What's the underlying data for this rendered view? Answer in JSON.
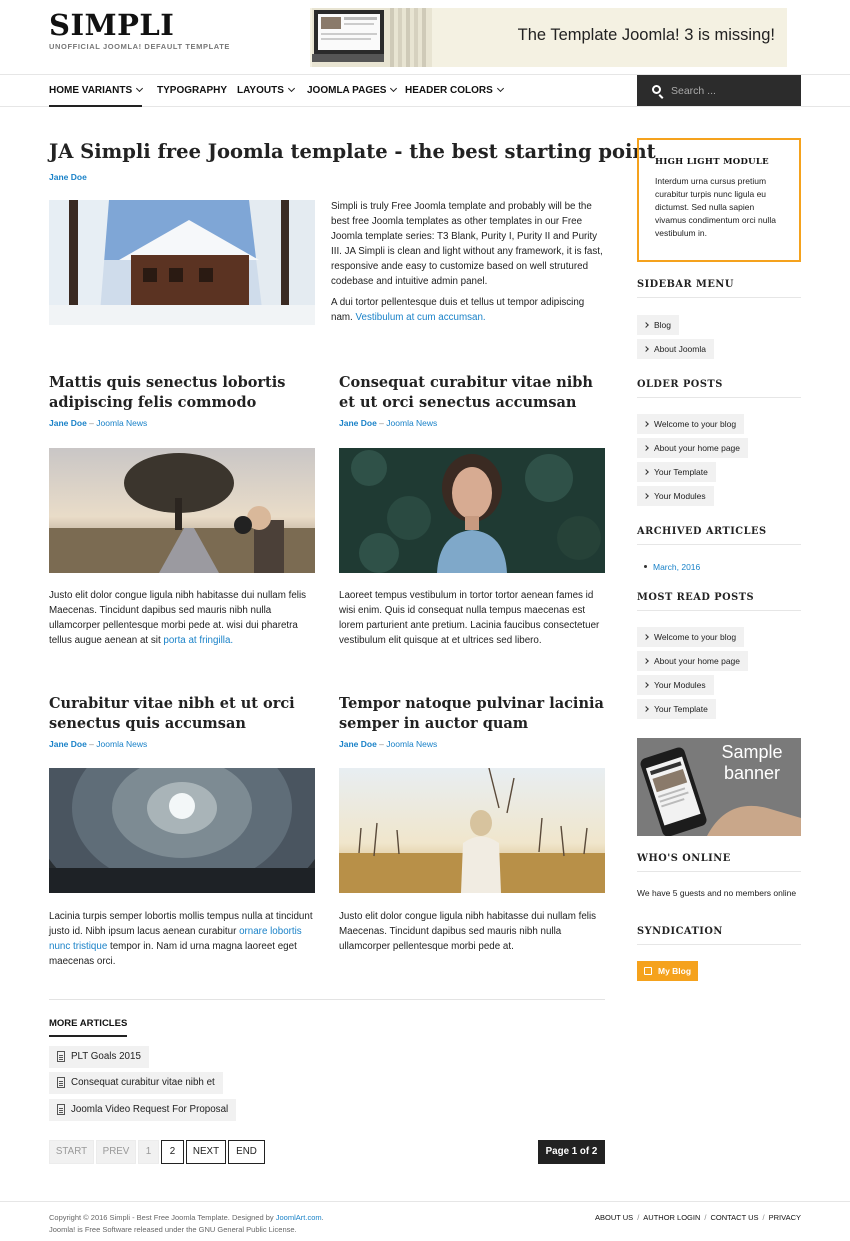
{
  "header": {
    "logo": "SIMPLI",
    "tagline": "UNOFFICIAL JOOMLA! DEFAULT TEMPLATE",
    "banner_text": "The Template Joomla! 3 is missing!"
  },
  "nav": {
    "items": [
      {
        "label": "HOME VARIANTS"
      },
      {
        "label": "TYPOGRAPHY"
      },
      {
        "label": "LAYOUTS"
      },
      {
        "label": "JOOMLA PAGES"
      },
      {
        "label": "HEADER COLORS"
      }
    ],
    "search_placeholder": "Search ..."
  },
  "featured": {
    "title": "JA Simpli free Joomla template - the best starting point",
    "author": "Jane Doe",
    "p1": "Simpli is truly Free Joomla template and probably will be the best free Joomla templates as other templates in our Free Joomla template series: T3 Blank, Purity I, Purity II and Purity III. JA Simpli is clean and light without any framework, it is fast, responsive ande easy to customize based on well strutured codebase and intuitive admin panel.",
    "p2": "A dui tortor pellentesque duis et tellus ut tempor adipiscing nam.",
    "p2_link": "Vestibulum at cum accumsan."
  },
  "articles": [
    {
      "title": "Mattis quis senectus lobortis adipiscing felis commodo",
      "author": "Jane Doe",
      "category": "Joomla News",
      "text": "Justo elit dolor congue ligula nibh habitasse dui nullam felis Maecenas. Tincidunt dapibus sed mauris nibh nulla ullamcorper pellentesque morbi pede at. wisi dui pharetra tellus augue aenean at sit",
      "link": "porta at fringilla.",
      "text_after": ""
    },
    {
      "title": "Consequat curabitur vitae nibh et ut orci senectus accumsan",
      "author": "Jane Doe",
      "category": "Joomla News",
      "text": "Laoreet tempus vestibulum in tortor tortor aenean fames id wisi enim. Quis id consequat nulla tempus maecenas est lorem parturient ante pretium. Lacinia faucibus consectetuer vestibulum elit quisque at et ultrices sed libero.",
      "link": "",
      "text_after": ""
    },
    {
      "title": "Curabitur vitae nibh et ut orci senectus quis accumsan",
      "author": "Jane Doe",
      "category": "Joomla News",
      "text": "Lacinia turpis semper lobortis mollis tempus nulla at tincidunt justo id. Nibh ipsum lacus aenean curabitur",
      "link": "ornare lobortis nunc tristique",
      "text_after": "tempor in. Nam id urna magna laoreet eget maecenas orci."
    },
    {
      "title": "Tempor natoque pulvinar lacinia semper in auctor quam",
      "author": "Jane Doe",
      "category": "Joomla News",
      "text": "Justo elit dolor congue ligula nibh habitasse dui nullam felis Maecenas. Tincidunt dapibus sed mauris nibh nulla ullamcorper pellentesque morbi pede at.",
      "link": "",
      "text_after": ""
    }
  ],
  "meta_sep": "–",
  "more_articles": {
    "title": "MORE ARTICLES",
    "items": [
      "PLT Goals 2015",
      "Consequat curabitur vitae nibh et",
      "Joomla Video Request For Proposal"
    ]
  },
  "pagination": {
    "start": "START",
    "prev": "PREV",
    "page1": "1",
    "page2": "2",
    "next": "NEXT",
    "end": "END",
    "count": "Page 1 of 2"
  },
  "sidebar": {
    "highlight_title": "HIGH LIGHT MODULE",
    "highlight_text": "Interdum urna cursus pretium curabitur turpis nunc ligula eu dictumst. Sed nulla sapien vivamus condimentum orci nulla vestibulum in.",
    "menu_title": "SIDEBAR MENU",
    "menu_items": [
      "Blog",
      "About Joomla"
    ],
    "older_title": "OLDER POSTS",
    "older_items": [
      "Welcome to your blog",
      "About your home page",
      "Your Template",
      "Your Modules"
    ],
    "archived_title": "ARCHIVED ARTICLES",
    "archived_item": "March, 2016",
    "mostread_title": "MOST READ POSTS",
    "mostread_items": [
      "Welcome to your blog",
      "About your home page",
      "Your Modules",
      "Your Template"
    ],
    "banner_text": "Sample banner",
    "online_title": "WHO'S ONLINE",
    "online_text": "We have 5 guests and no members online",
    "syndication_title": "SYNDICATION",
    "myblog": "My Blog"
  },
  "footer": {
    "copy_prefix": "Copyright © 2016 Simpli - Best Free Joomla Template. Designed by",
    "copy_link": "JoomlArt.com",
    "copy_suffix": ".",
    "copy_line2": "Joomla! is Free Software released under the GNU General Public License.",
    "links": [
      "ABOUT US",
      "AUTHOR LOGIN",
      "CONTACT US",
      "PRIVACY"
    ]
  },
  "colors": {
    "accent": "#f5a21d",
    "link": "#1a82c8",
    "dark": "#222222"
  }
}
